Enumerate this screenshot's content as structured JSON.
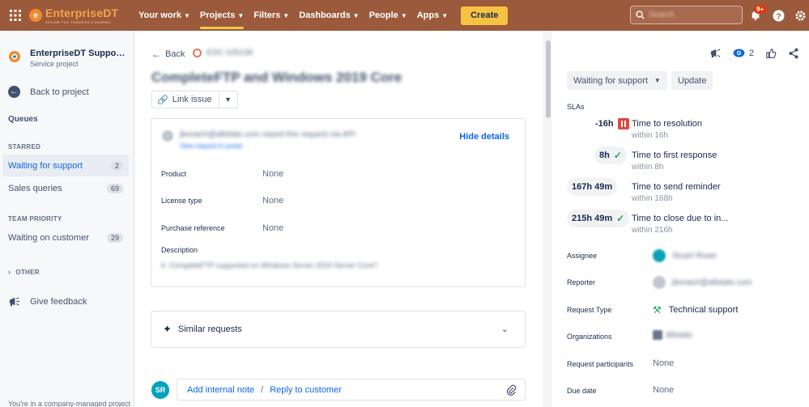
{
  "topbar": {
    "brand": "EnterpriseDT",
    "brand_tagline": "SECURE FILE TRANSFER & SHARING",
    "nav": [
      {
        "label": "Your work",
        "chevron": true
      },
      {
        "label": "Projects",
        "chevron": true,
        "active": true
      },
      {
        "label": "Filters",
        "chevron": true
      },
      {
        "label": "Dashboards",
        "chevron": true
      },
      {
        "label": "People",
        "chevron": true
      },
      {
        "label": "Apps",
        "chevron": true
      }
    ],
    "create_label": "Create",
    "search_placeholder": "Search",
    "notifications_badge": "9+"
  },
  "sidebar": {
    "project_name": "EnterpriseDT Support C...",
    "project_type": "Service project",
    "back_label": "Back to project",
    "queues_heading": "Queues",
    "starred_heading": "STARRED",
    "starred_items": [
      {
        "label": "Waiting for support",
        "count": "2",
        "selected": true
      },
      {
        "label": "Sales queries",
        "count": "69"
      }
    ],
    "team_heading": "TEAM PRIORITY",
    "team_items": [
      {
        "label": "Waiting on customer",
        "count": "29"
      }
    ],
    "other_heading": "OTHER",
    "feedback_label": "Give feedback",
    "footer_text": "You're in a company-managed project"
  },
  "issue": {
    "back_label": "Back",
    "key": "ESC-105130",
    "title": "CompleteFTP and Windows 2019 Core",
    "link_issue_label": "Link issue",
    "requester_line": "jbonach@allstate.com raised this request via API",
    "requester_sub": "View request in portal",
    "hide_details_label": "Hide details",
    "fields": [
      {
        "label": "Product",
        "value": "None"
      },
      {
        "label": "License type",
        "value": "None"
      },
      {
        "label": "Purchase reference",
        "value": "None"
      }
    ],
    "description_label": "Description",
    "description_text": "6. CompleteFTP supported on Windows Server 2019 Server Core?",
    "similar_label": "Similar requests",
    "commenter_initials": "SR",
    "add_internal_note": "Add internal note",
    "reply_to_customer": "Reply to customer"
  },
  "right": {
    "watchers_count": "2",
    "status_label": "Waiting for support",
    "update_label": "Update",
    "slas_label": "SLAs",
    "slas": [
      {
        "time": "-16h",
        "state": "paused",
        "name": "Time to resolution",
        "target": "within 16h"
      },
      {
        "time": "8h",
        "state": "met",
        "name": "Time to first response",
        "target": "within 8h"
      },
      {
        "time": "167h 49m",
        "state": "met",
        "name": "Time to send reminder",
        "target": "within 168h"
      },
      {
        "time": "215h 49m",
        "state": "met",
        "name": "Time to close due to in...",
        "target": "within 216h"
      }
    ],
    "details": {
      "assignee_label": "Assignee",
      "assignee_value": "Stuart Rowe",
      "reporter_label": "Reporter",
      "reporter_value": "jbonach@allstate.com",
      "request_type_label": "Request Type",
      "request_type_value": "Technical support",
      "organizations_label": "Organizations",
      "organizations_value": "Allstate",
      "participants_label": "Request participants",
      "participants_value": "None",
      "due_date_label": "Due date",
      "due_date_value": "None"
    }
  },
  "colors": {
    "topbar": "#9b5a3c",
    "accent": "#0c66e4",
    "create": "#f7c242",
    "pause": "#e2483d",
    "check": "#22a06b"
  }
}
